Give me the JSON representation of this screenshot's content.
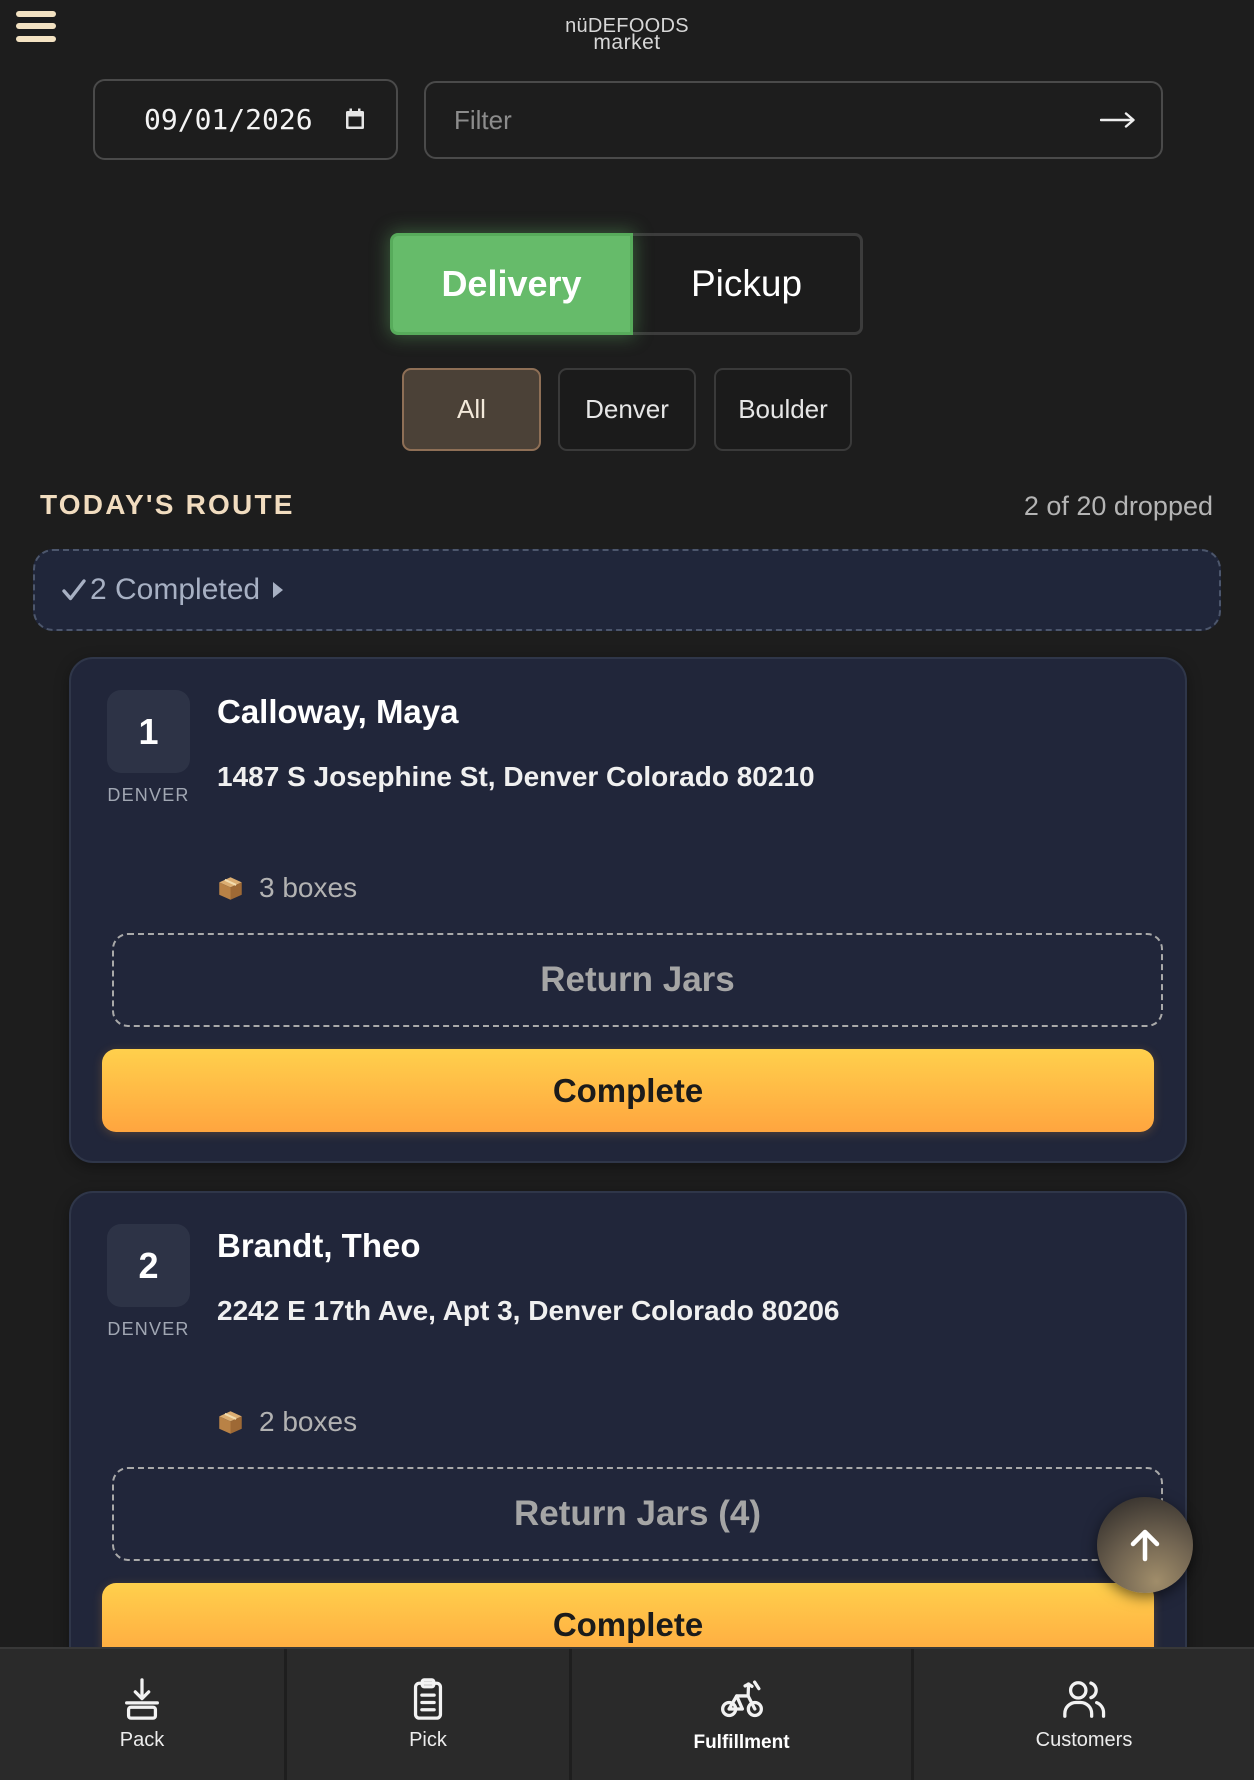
{
  "brand": {
    "name": "nüDEFOODS",
    "tagline": "market"
  },
  "header": {
    "menu_icon": "hamburger-menu-icon"
  },
  "date_filter": {
    "value": "09/01/2026",
    "icon": "calendar-icon"
  },
  "search": {
    "placeholder": "Filter",
    "value": "",
    "submit_icon": "arrow-right-icon"
  },
  "mode_toggle": {
    "options": [
      {
        "label": "Delivery",
        "active": true
      },
      {
        "label": "Pickup",
        "active": false
      }
    ]
  },
  "region_filter": {
    "options": [
      {
        "label": "All",
        "active": true
      },
      {
        "label": "Denver",
        "active": false
      },
      {
        "label": "Boulder",
        "active": false
      }
    ]
  },
  "route": {
    "title": "TODAY'S ROUTE",
    "progress": "2 of 20 dropped",
    "completed_summary": {
      "label": "2 Completed",
      "check_icon": "check-icon",
      "expand_icon": "caret-right-icon",
      "expanded": false
    }
  },
  "stops": [
    {
      "number": "1",
      "region": "DENVER",
      "name": "Calloway, Maya",
      "address": "1487 S Josephine St, Denver Colorado 80210",
      "box_icon": "package-icon",
      "boxes": "3 boxes",
      "return_label": "Return Jars",
      "complete_label": "Complete"
    },
    {
      "number": "2",
      "region": "DENVER",
      "name": "Brandt, Theo",
      "address": "2242 E 17th Ave, Apt 3, Denver Colorado 80206",
      "box_icon": "package-icon",
      "boxes": "2 boxes",
      "return_label": "Return Jars (4)",
      "complete_label": "Complete"
    }
  ],
  "scroll_top": {
    "icon": "arrow-up-icon"
  },
  "bottom_nav": {
    "items": [
      {
        "label": "Pack",
        "icon": "download-tray-icon",
        "active": false
      },
      {
        "label": "Pick",
        "icon": "clipboard-icon",
        "active": false
      },
      {
        "label": "Fulfillment",
        "icon": "bicycle-icon",
        "active": true
      },
      {
        "label": "Customers",
        "icon": "users-icon",
        "active": false
      }
    ]
  },
  "colors": {
    "background": "#1d1d1d",
    "menu_icon": "#f3e2c2",
    "heading": "#f1dcbf",
    "delivery_active": "#66bb6a",
    "region_active_bg": "#4b4137",
    "card_background": "#21263a",
    "complete_top": "#ffd04c",
    "complete_bottom": "#ffa53f"
  }
}
